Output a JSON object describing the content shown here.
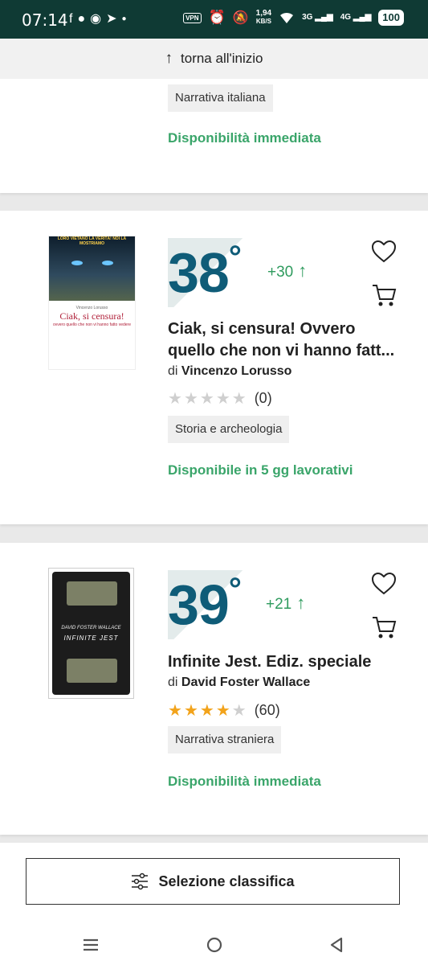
{
  "status_bar": {
    "time": "07:14",
    "left_icons": [
      "facebook-icon",
      "messenger-chat-icon",
      "messenger-icon",
      "telegram-icon",
      "dot-icon"
    ],
    "vpn": "VPN",
    "speed_value": "1,94",
    "speed_unit": "KB/S",
    "net1": "3G",
    "net2": "4G",
    "battery": "100"
  },
  "top_bar": {
    "label": "torna all'inizio"
  },
  "cards": [
    {
      "tag": "Narrativa italiana",
      "availability": "Disponibilità immediata"
    },
    {
      "cover_top": "LORO VIETANO LA VERITÀ! NOI LA MOSTRIAMO",
      "cover_author": "Vincenzo Lorusso",
      "cover_title": "Ciak, si censura!",
      "cover_subtitle": "ovvero quello che non vi hanno fatto vedere",
      "rank": "38",
      "delta": "+30",
      "title": "Ciak, si censura! Ovvero quello che non vi hanno fatt...",
      "author_prefix": "di",
      "author": "Vincenzo Lorusso",
      "rating": 0,
      "reviews": "(0)",
      "tag": "Storia e archeologia",
      "availability": "Disponibile in 5 gg lavorativi"
    },
    {
      "cover_author": "DAVID FOSTER WALLACE",
      "cover_title": "INFINITE JEST",
      "rank": "39",
      "delta": "+21",
      "title": "Infinite Jest. Ediz. speciale",
      "author_prefix": "di",
      "author": "David Foster Wallace",
      "rating": 4,
      "reviews": "(60)",
      "tag": "Narrativa straniera",
      "availability": "Disponibilità immediata"
    }
  ],
  "bottom": {
    "selection_label": "Selezione classifica"
  },
  "colors": {
    "status_bar": "#0f3a34",
    "rank": "#0f5c78",
    "green": "#2f9b5e",
    "star": "#f2a31b"
  }
}
